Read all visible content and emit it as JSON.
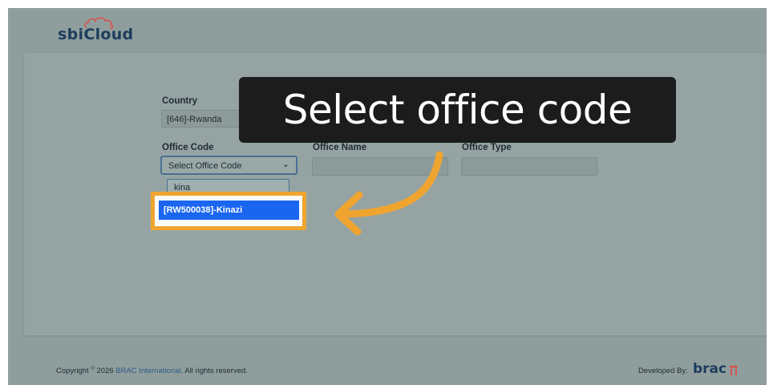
{
  "app": {
    "logo_text": "sbiCloud"
  },
  "form": {
    "country_label": "Country",
    "country_value": "[646]-Rwanda",
    "office_code_label": "Office Code",
    "office_code_select": "Select Office Code",
    "office_code_search": "kina",
    "office_code_option": "[RW500038]-Kinazi",
    "office_name_label": "Office Name",
    "office_type_label": "Office Type"
  },
  "overlay": {
    "caption": "Select office code",
    "accent_color": "#f0a430"
  },
  "footer": {
    "copyright_prefix": "Copyright",
    "copyright_symbol": "©",
    "copyright_year": "2026",
    "org_link": "BRAC International",
    "rights": ". All rights reserved.",
    "developed_by": "Developed By:",
    "brand": "brac"
  }
}
